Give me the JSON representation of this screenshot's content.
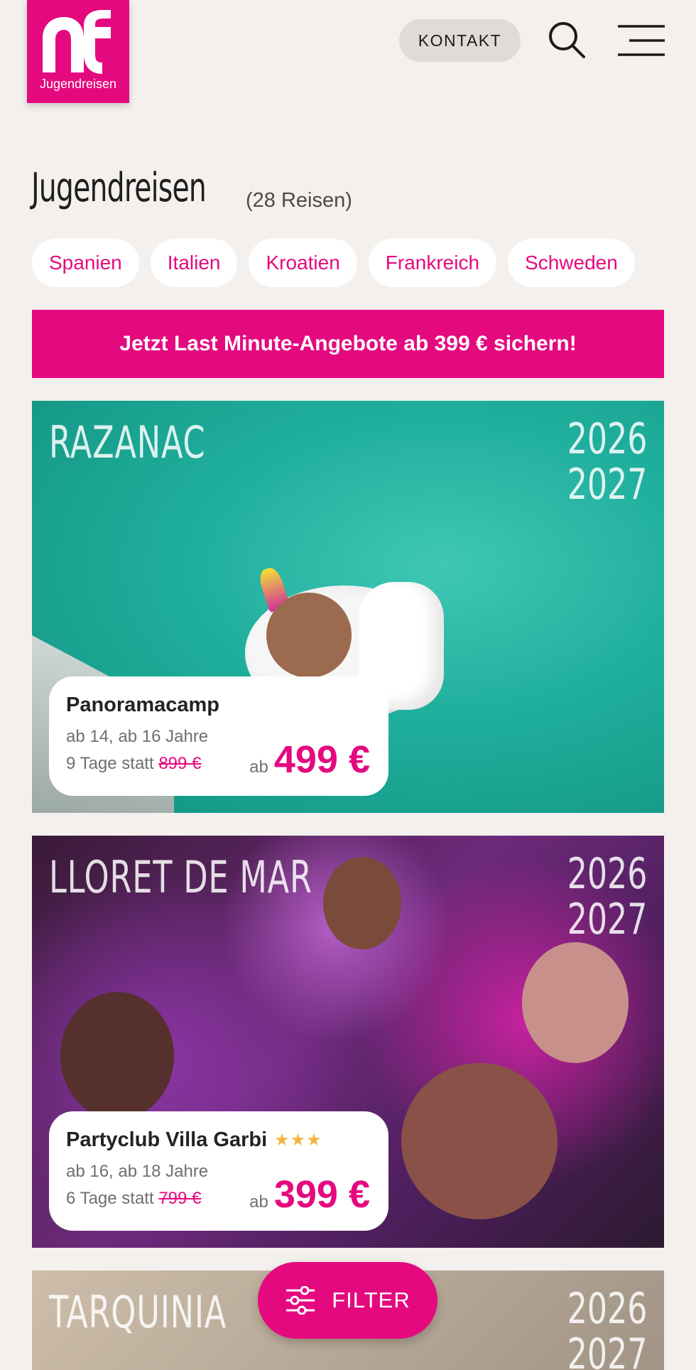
{
  "logo": {
    "text": "Jugendreisen"
  },
  "header": {
    "contact_label": "KONTAKT"
  },
  "page": {
    "title": "Jugendreisen",
    "count": "(28 Reisen)"
  },
  "countries": [
    "Spanien",
    "Italien",
    "Kroatien",
    "Frankreich",
    "Schweden"
  ],
  "banner": {
    "text": "Jetzt Last Minute-Angebote ab 399 € sichern!"
  },
  "trips": [
    {
      "city": "RAZANAC",
      "year1": "2026",
      "year2": "2027",
      "name": "Panoramacamp",
      "stars": "",
      "ages": "ab 14, ab 16 Jahre",
      "days": "9 Tage statt",
      "old_price": "899 €",
      "price_prefix": "ab",
      "price": "499 €"
    },
    {
      "city": "LLORET DE MAR",
      "year1": "2026",
      "year2": "2027",
      "name": "Partyclub Villa Garbi",
      "stars": "★★★",
      "ages": "ab 16, ab 18 Jahre",
      "days": "6 Tage statt",
      "old_price": "799 €",
      "price_prefix": "ab",
      "price": "399 €"
    },
    {
      "city": "TARQUINIA",
      "year1": "2026",
      "year2": "2027"
    }
  ],
  "filter": {
    "label": "FILTER"
  },
  "colors": {
    "brand": "#e5097f",
    "background": "#f4f0ed",
    "star": "#f1b53a"
  },
  "icons": [
    "logo-icon",
    "search-icon",
    "menu-icon",
    "filter-sliders-icon"
  ]
}
